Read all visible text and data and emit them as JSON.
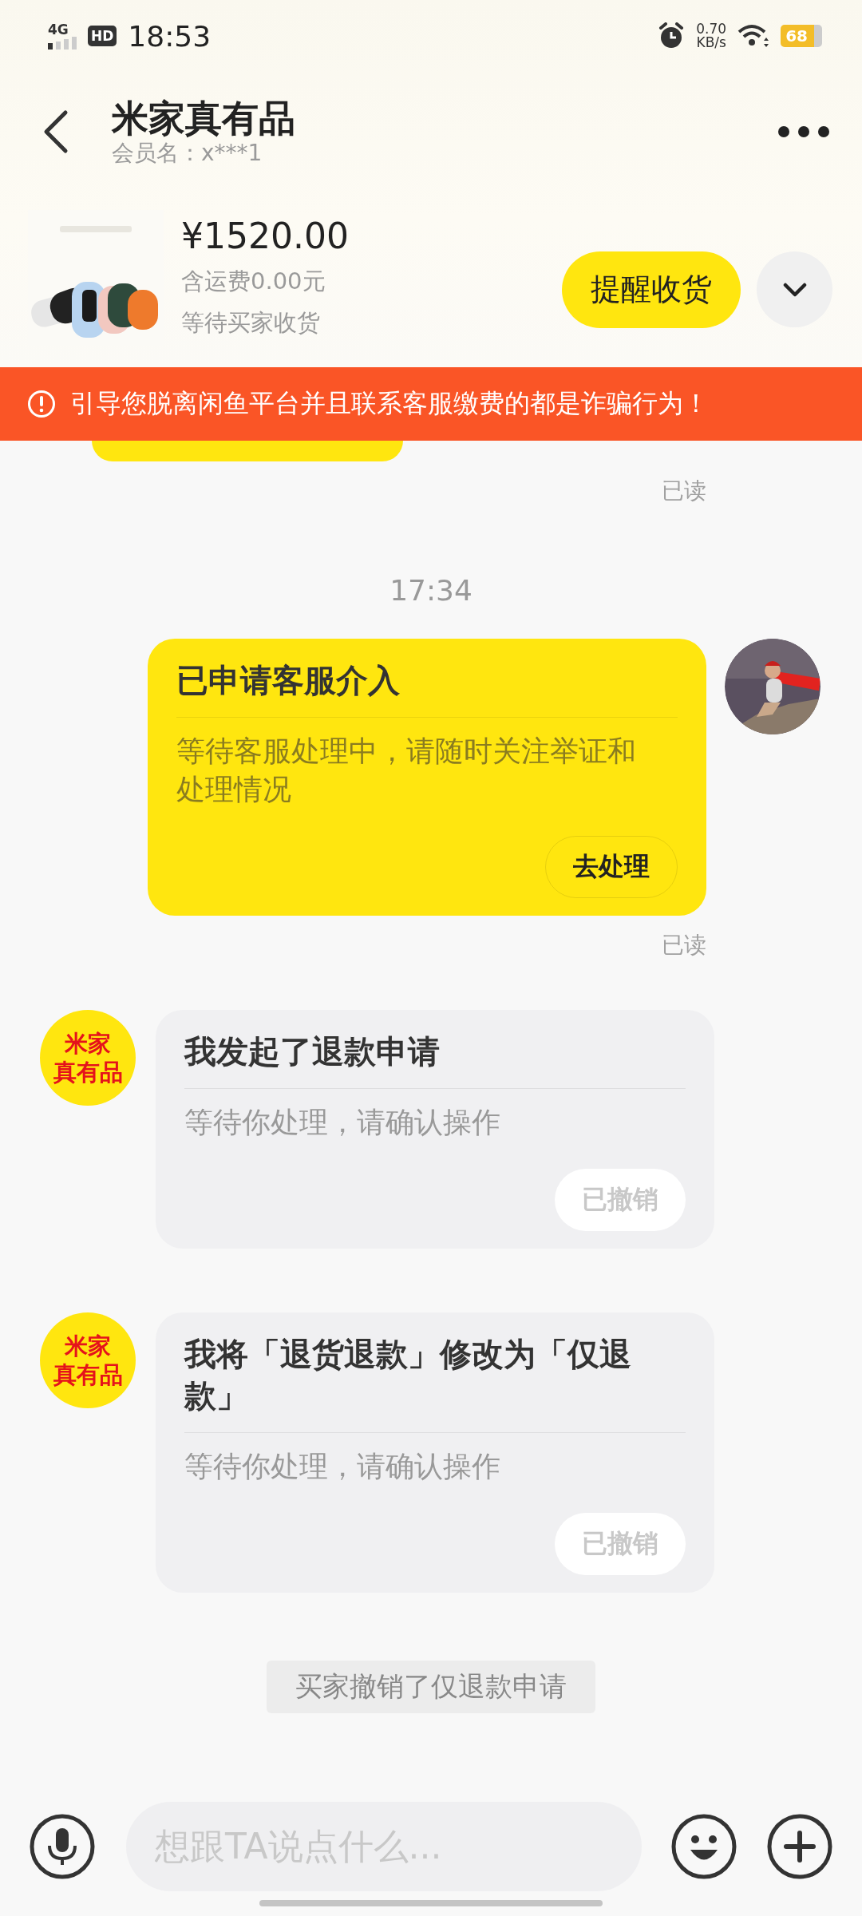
{
  "status_bar": {
    "network": "4G",
    "hd": "HD",
    "time": "18:53",
    "speed": "0.70",
    "speed_unit": "KB/s",
    "battery": "68"
  },
  "header": {
    "title": "米家真有品",
    "subtitle": "会员名：x***1"
  },
  "order": {
    "price": "¥1520.00",
    "shipping": "含运费0.00元",
    "status": "等待买家收货",
    "action": "提醒收货"
  },
  "warning": "引导您脱离闲鱼平台并且联系客服缴费的都是诈骗行为！",
  "messages": [
    {
      "kind": "bubble_tail"
    },
    {
      "kind": "read",
      "text": "已读"
    },
    {
      "kind": "time",
      "text": "17:34"
    },
    {
      "kind": "my_card",
      "title": "已申请客服介入",
      "body": "等待客服处理中，请随时关注举证和处理情况",
      "button": {
        "label": "去处理",
        "disabled": false
      }
    },
    {
      "kind": "read",
      "text": "已读"
    },
    {
      "kind": "seller_card",
      "avatar": [
        "米家",
        "真有品"
      ],
      "title": "我发起了退款申请",
      "body": "等待你处理，请确认操作",
      "button": {
        "label": "已撤销",
        "disabled": true
      }
    },
    {
      "kind": "seller_card",
      "avatar": [
        "米家",
        "真有品"
      ],
      "title": "我将「退货退款」修改为「仅退款」",
      "body": "等待你处理，请确认操作",
      "button": {
        "label": "已撤销",
        "disabled": true
      }
    },
    {
      "kind": "system",
      "text": "买家撤销了仅退款申请"
    }
  ],
  "input": {
    "placeholder": "想跟TA说点什么..."
  }
}
